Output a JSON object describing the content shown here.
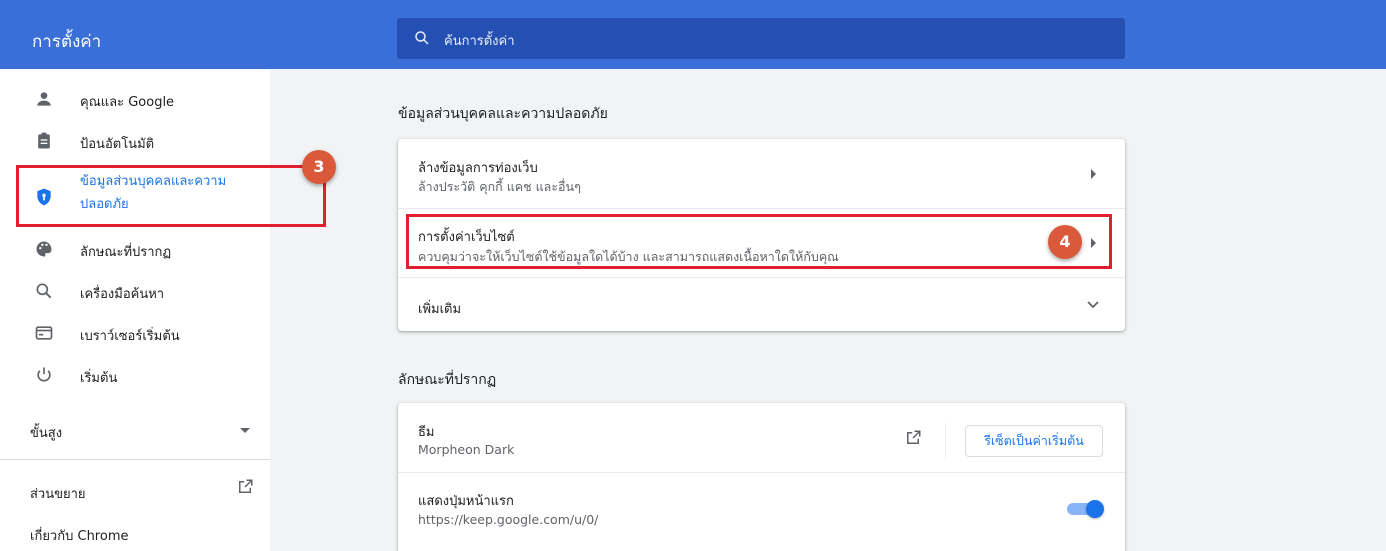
{
  "header": {
    "title": "การตั้งค่า",
    "search_placeholder": "ค้นการตั้งค่า"
  },
  "sidebar": {
    "items": [
      {
        "label": "คุณและ Google",
        "icon": "person-icon"
      },
      {
        "label": "ป้อนอัตโนมัติ",
        "icon": "clipboard-icon"
      },
      {
        "label_line1": "ข้อมูลส่วนบุคคลและความ",
        "label_line2": "ปลอดภัย",
        "icon": "shield-icon"
      },
      {
        "label": "ลักษณะที่ปรากฏ",
        "icon": "palette-icon"
      },
      {
        "label": "เครื่องมือค้นหา",
        "icon": "search-icon"
      },
      {
        "label": "เบราว์เซอร์เริ่มต้น",
        "icon": "browser-icon"
      },
      {
        "label": "เริ่มต้น",
        "icon": "power-icon"
      }
    ],
    "advanced": "ขั้นสูง",
    "extensions": "ส่วนขยาย",
    "about": "เกี่ยวกับ Chrome"
  },
  "annotations": {
    "badge3": "3",
    "badge4": "4"
  },
  "privacy": {
    "section_title": "ข้อมูลส่วนบุคคลและความปลอดภัย",
    "rows": [
      {
        "title": "ล้างข้อมูลการท่องเว็บ",
        "subtitle": "ล้างประวัติ คุกกี้ แคช และอื่นๆ"
      },
      {
        "title": "การตั้งค่าเว็บไซต์",
        "subtitle": "ควบคุมว่าจะให้เว็บไซต์ใช้ข้อมูลใดได้บ้าง และสามารถแสดงเนื้อหาใดให้กับคุณ"
      },
      {
        "title": "เพิ่มเติม"
      }
    ]
  },
  "appearance": {
    "section_title": "ลักษณะที่ปรากฏ",
    "theme_title": "ธีม",
    "theme_value": "Morpheon Dark",
    "reset_label": "รีเซ็ตเป็นค่าเริ่มต้น",
    "home_title": "แสดงปุ่มหน้าแรก",
    "home_value": "https://keep.google.com/u/0/",
    "home_enabled": true
  },
  "colors": {
    "header": "#3b6fd8",
    "accent": "#1a73e8",
    "highlight": "#e0202f",
    "badge": "#d9593a"
  }
}
